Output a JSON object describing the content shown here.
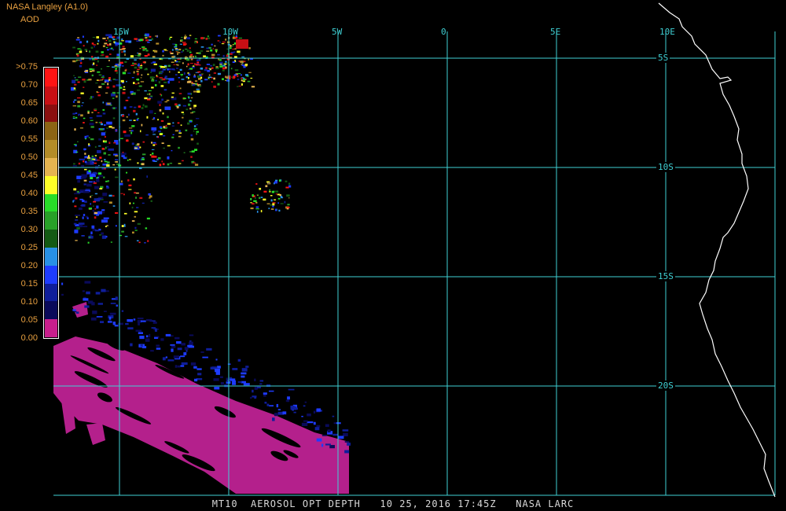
{
  "header": {
    "title": "NASA Langley (A1.0)",
    "variable": "AOD"
  },
  "legend": {
    "labels": [
      ">0.75",
      "0.70",
      "0.65",
      "0.60",
      "0.55",
      "0.50",
      "0.45",
      "0.40",
      "0.35",
      "0.30",
      "0.25",
      "0.20",
      "0.15",
      "0.10",
      "0.05",
      "0.00"
    ],
    "colors": [
      "#ff1414",
      "#c80f14",
      "#8a0f0f",
      "#8c6414",
      "#b48c28",
      "#e6b450",
      "#ffff28",
      "#28dc28",
      "#28a028",
      "#145a14",
      "#2890e6",
      "#1e3cff",
      "#0f1e9a",
      "#0a0a5a",
      "#c81e8c"
    ]
  },
  "map": {
    "lon_labels": [
      "15W",
      "10W",
      "5W",
      "0",
      "5E",
      "10E"
    ],
    "lat_labels": [
      "5S",
      "10S",
      "15S",
      "20S"
    ],
    "grid_color": "#3fd0d4",
    "coast_color": "#ffffff",
    "low_aod_color": "#b4208c"
  },
  "footer": "MT10  AEROSOL OPT DEPTH   10 25, 2016 17:45Z   NASA LARC"
}
